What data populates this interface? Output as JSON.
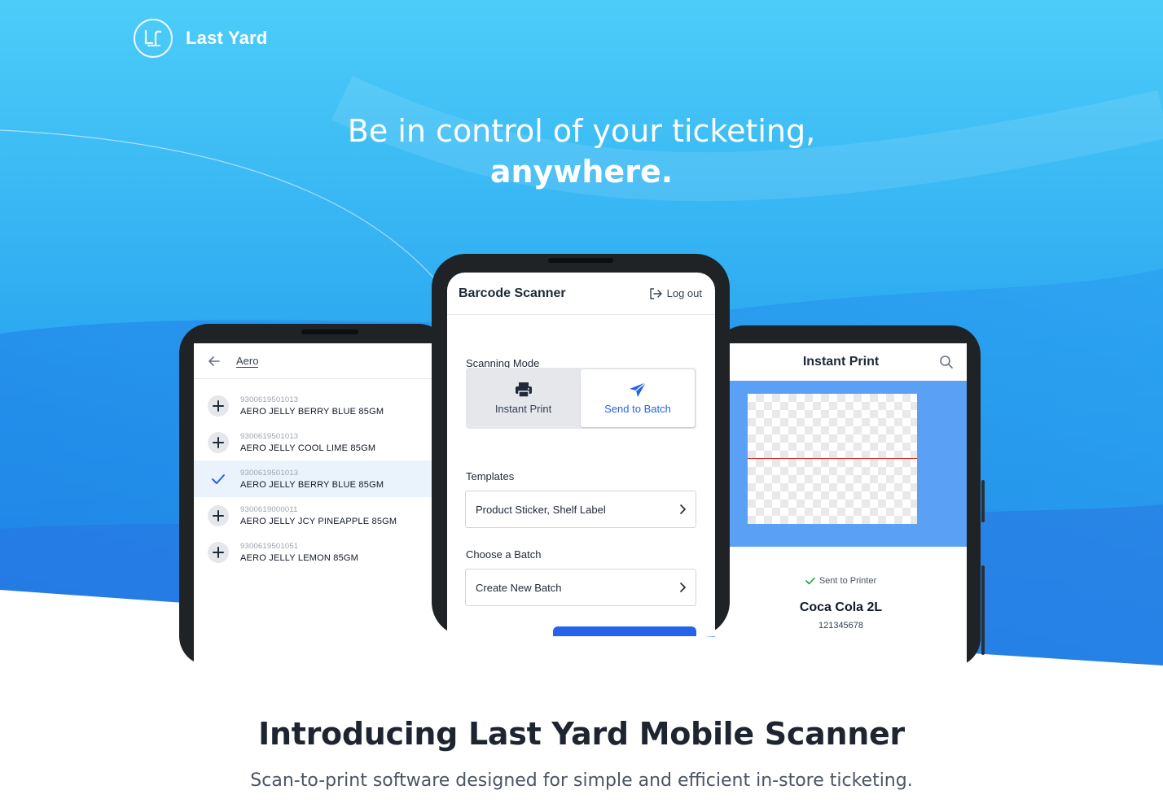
{
  "brand": {
    "name": "Last Yard"
  },
  "hero": {
    "headline_line1": "Be in control of your ticketing,",
    "headline_line2": "anywhere."
  },
  "left_phone": {
    "search_query": "Aero",
    "products": [
      {
        "code": "9300619501013",
        "name": "AERO JELLY BERRY BLUE 85GM",
        "selected": false
      },
      {
        "code": "9300619501013",
        "name": "AERO JELLY COOL LIME 85GM",
        "selected": false
      },
      {
        "code": "9300619501013",
        "name": "AERO JELLY BERRY BLUE 85GM",
        "selected": true
      },
      {
        "code": "9300619000011",
        "name": "AERO JELLY JCY PINEAPPLE 85GM",
        "selected": false
      },
      {
        "code": "9300619501051",
        "name": "AERO JELLY LEMON 85GM",
        "selected": false
      }
    ]
  },
  "center_phone": {
    "title": "Barcode Scanner",
    "logout_label": "Log out",
    "scanning_mode_label": "Scanning Mode",
    "mode_instant_print": "Instant Print",
    "mode_send_to_batch": "Send to Batch",
    "templates_label": "Templates",
    "templates_value": "Product Sticker, Shelf Label",
    "batch_label": "Choose a Batch",
    "batch_value": "Create New Batch"
  },
  "right_phone": {
    "title": "Instant Print",
    "status": "Sent to Printer",
    "product_name": "Coca Cola 2L",
    "product_code": "121345678"
  },
  "intro": {
    "title": "Introducing Last Yard Mobile Scanner",
    "subtitle": "Scan-to-print software designed for simple and efficient in-store ticketing."
  },
  "colors": {
    "accent": "#2563eb",
    "hero_top": "#4ccdf8",
    "hero_bottom": "#1d84e8"
  },
  "icons": [
    "logo-icon",
    "back-arrow-icon",
    "plus-icon",
    "check-icon",
    "logout-icon",
    "printer-icon",
    "send-icon",
    "chevron-right-icon",
    "search-icon"
  ]
}
